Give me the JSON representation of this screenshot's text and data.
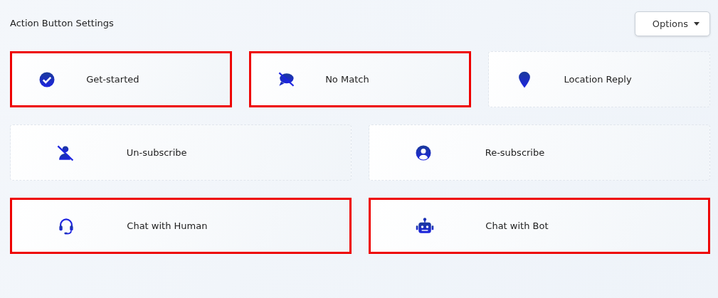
{
  "header": {
    "title": "Action Button Settings",
    "options_button": {
      "label": "Options"
    }
  },
  "rows": [
    [
      {
        "label": "Get-started",
        "kind": "check",
        "highlighted": true
      },
      {
        "label": "No Match",
        "kind": "nomatch",
        "highlighted": true
      },
      {
        "label": "Location Reply",
        "kind": "location",
        "highlighted": false
      }
    ],
    [
      {
        "label": "Un-subscribe",
        "kind": "unsubscribe",
        "highlighted": false
      },
      {
        "label": "Re-subscribe",
        "kind": "resubscribe",
        "highlighted": false
      }
    ],
    [
      {
        "label": "Chat with Human",
        "kind": "human",
        "highlighted": true
      },
      {
        "label": "Chat with Bot",
        "kind": "bot",
        "highlighted": true
      }
    ]
  ]
}
